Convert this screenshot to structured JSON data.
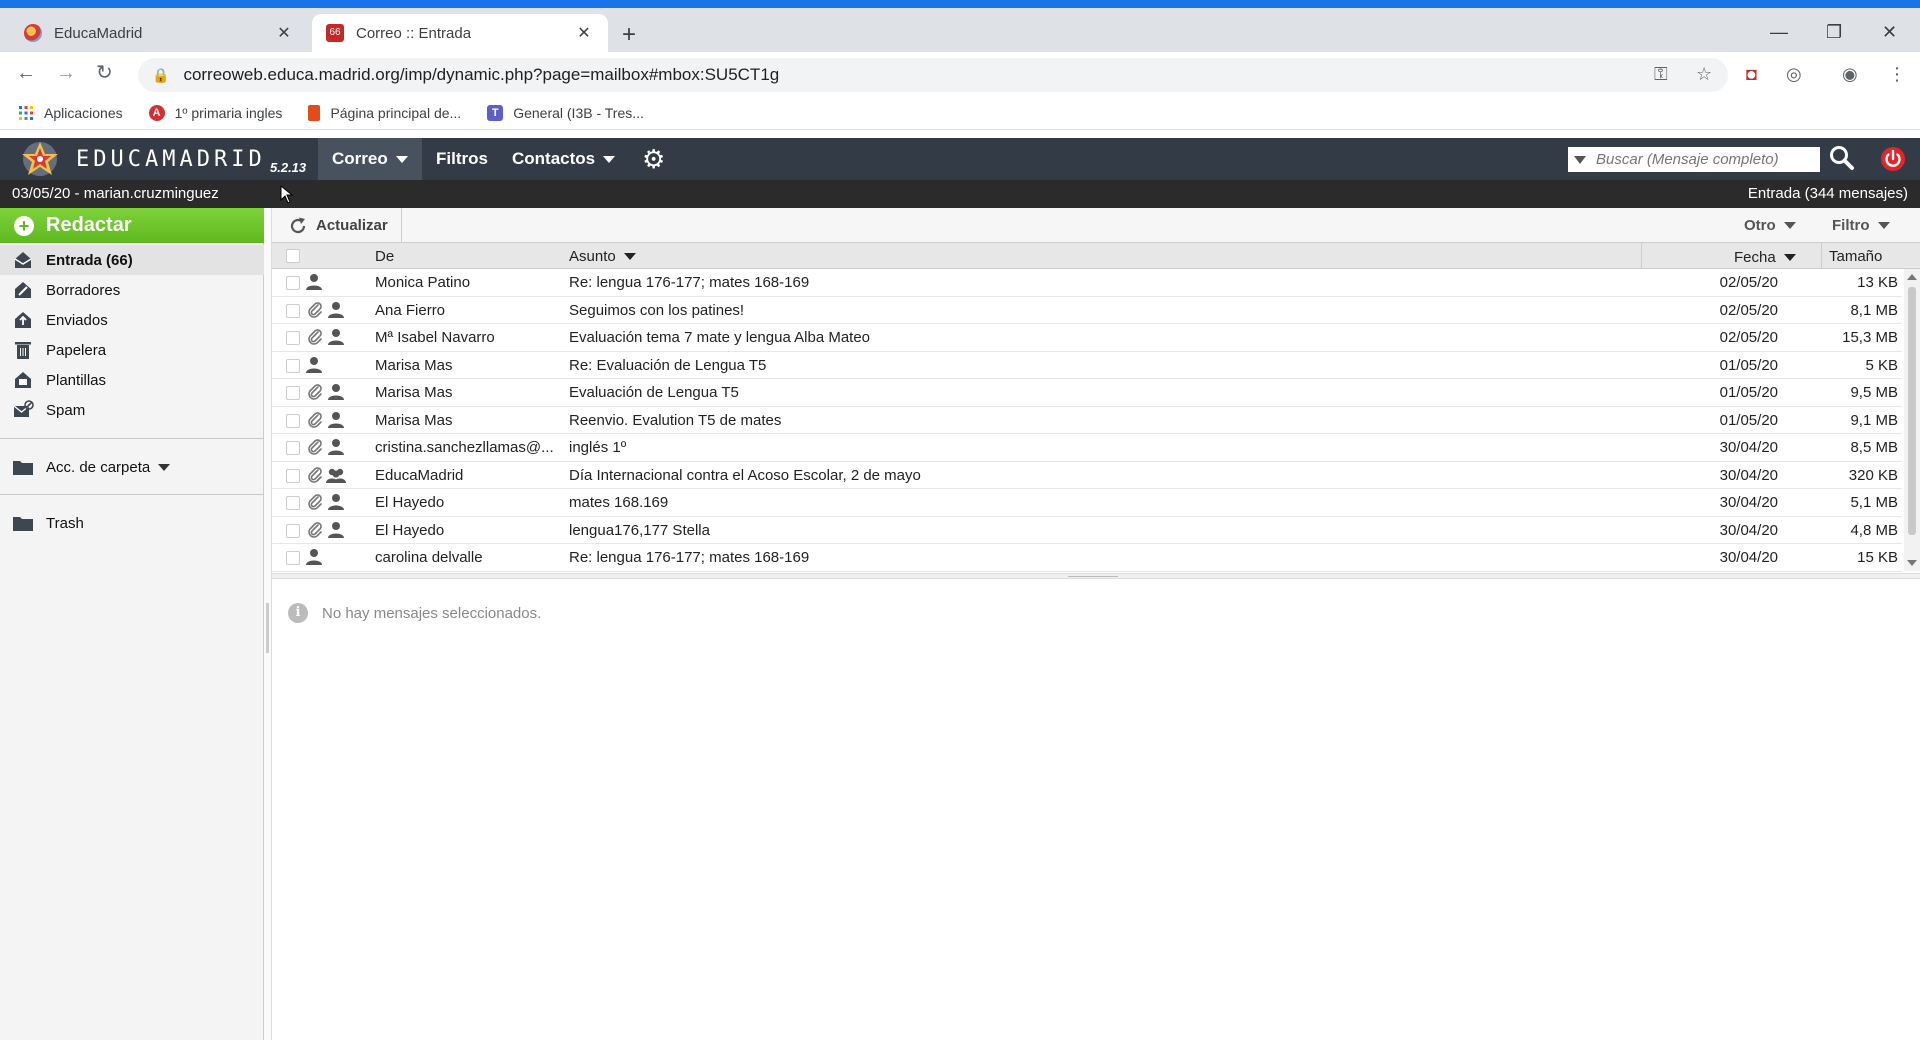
{
  "browser": {
    "tabs": [
      {
        "title": "EducaMadrid",
        "active": false
      },
      {
        "title": "Correo :: Entrada",
        "active": true
      }
    ],
    "url": "correoweb.educa.madrid.org/imp/dynamic.php?page=mailbox#mbox:SU5CT1g",
    "bookmarks": [
      {
        "label": "Aplicaciones",
        "icon": "apps-grid-icon"
      },
      {
        "label": "1º primaria ingles",
        "icon": "bookmark-a-icon"
      },
      {
        "label": "Página principal de...",
        "icon": "office-icon"
      },
      {
        "label": "General (I3B - Tres...",
        "icon": "teams-icon"
      }
    ]
  },
  "app": {
    "logo_text": "EDUCAMADRID",
    "version": "5.2.13",
    "menu": {
      "mail": "Correo",
      "filters": "Filtros",
      "contacts": "Contactos"
    },
    "search_placeholder": "Buscar (Mensaje completo)",
    "status_left": "03/05/20 - marian.cruzminguez",
    "status_right": "Entrada (344 mensajes)"
  },
  "sidebar": {
    "compose": "Redactar",
    "folders": [
      {
        "label": "Entrada (66)",
        "icon": "inbox-icon",
        "selected": true
      },
      {
        "label": "Borradores",
        "icon": "drafts-icon"
      },
      {
        "label": "Enviados",
        "icon": "sent-icon"
      },
      {
        "label": "Papelera",
        "icon": "trash-can-icon"
      },
      {
        "label": "Plantillas",
        "icon": "templates-icon"
      },
      {
        "label": "Spam",
        "icon": "spam-icon"
      }
    ],
    "folder_actions": "Acc. de carpeta",
    "extra_folders": [
      {
        "label": "Trash",
        "icon": "folder-icon"
      }
    ]
  },
  "mailbox": {
    "refresh": "Actualizar",
    "other": "Otro",
    "filter": "Filtro",
    "columns": {
      "from": "De",
      "subject": "Asunto",
      "date": "Fecha",
      "size": "Tamaño"
    },
    "messages": [
      {
        "from": "Monica Patino",
        "subject": "Re: lengua 176-177; mates 168-169",
        "date": "02/05/20",
        "size": "13 KB",
        "attachment": false,
        "group": false
      },
      {
        "from": "Ana Fierro",
        "subject": "Seguimos con los patines!",
        "date": "02/05/20",
        "size": "8,1 MB",
        "attachment": true,
        "group": false
      },
      {
        "from": "Mª Isabel Navarro",
        "subject": "Evaluación tema 7 mate y lengua Alba Mateo",
        "date": "02/05/20",
        "size": "15,3 MB",
        "attachment": true,
        "group": false
      },
      {
        "from": "Marisa Mas",
        "subject": "Re: Evaluación de Lengua T5",
        "date": "01/05/20",
        "size": "5 KB",
        "attachment": false,
        "group": false
      },
      {
        "from": "Marisa Mas",
        "subject": "Evaluación de Lengua T5",
        "date": "01/05/20",
        "size": "9,5 MB",
        "attachment": true,
        "group": false
      },
      {
        "from": "Marisa Mas",
        "subject": "Reenvio. Evalution T5 de mates",
        "date": "01/05/20",
        "size": "9,1 MB",
        "attachment": true,
        "group": false
      },
      {
        "from": "cristina.sanchezllamas@...",
        "subject": "inglés 1º",
        "date": "30/04/20",
        "size": "8,5 MB",
        "attachment": true,
        "group": false
      },
      {
        "from": "EducaMadrid",
        "subject": "Día Internacional contra el Acoso Escolar, 2 de mayo",
        "date": "30/04/20",
        "size": "320 KB",
        "attachment": true,
        "group": true
      },
      {
        "from": "El Hayedo",
        "subject": "mates 168.169",
        "date": "30/04/20",
        "size": "5,1 MB",
        "attachment": true,
        "group": false
      },
      {
        "from": "El Hayedo",
        "subject": "lengua176,177 Stella",
        "date": "30/04/20",
        "size": "4,8 MB",
        "attachment": true,
        "group": false
      },
      {
        "from": "carolina delvalle",
        "subject": "Re: lengua 176-177; mates 168-169",
        "date": "30/04/20",
        "size": "15 KB",
        "attachment": false,
        "group": false
      }
    ],
    "preview_empty": "No hay mensajes seleccionados."
  },
  "colors": {
    "chrome_accent": "#1a73e8",
    "app_header": "#333c46",
    "compose_green": "#6cc72c",
    "power_red": "#e0252b"
  }
}
